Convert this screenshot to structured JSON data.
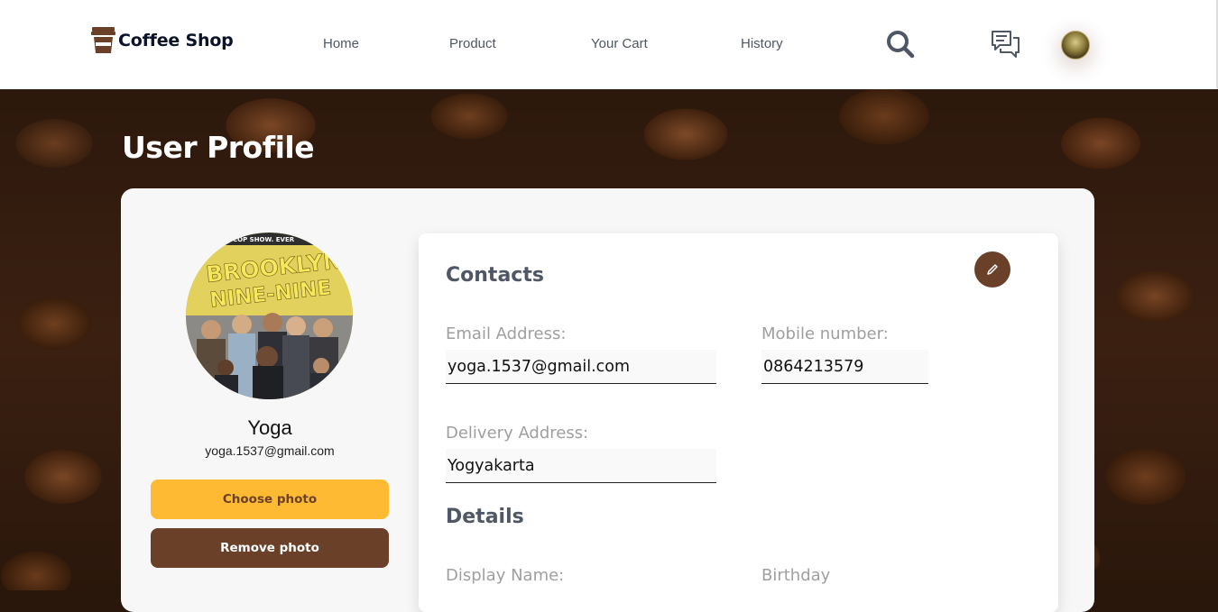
{
  "header": {
    "brand": "Coffee Shop",
    "nav": [
      "Home",
      "Product",
      "Your Cart",
      "History"
    ],
    "icons": [
      "search-icon",
      "chat-icon",
      "user-avatar"
    ]
  },
  "page": {
    "title": "User Profile"
  },
  "profile": {
    "name": "Yoga",
    "email": "yoga.1537@gmail.com",
    "poster_text": [
      "COP SHOW. EVER",
      "BROOKLYN",
      "NINE-NINE"
    ],
    "choose_photo": "Choose photo",
    "remove_photo": "Remove photo"
  },
  "contacts": {
    "title": "Contacts",
    "email_label": "Email Address:",
    "email_value": "yoga.1537@gmail.com",
    "mobile_label": "Mobile number:",
    "mobile_value": "0864213579",
    "address_label": "Delivery Address:",
    "address_value": "Yogyakarta"
  },
  "details": {
    "title": "Details",
    "display_name_label": "Display Name:",
    "birthday_label": "Birthday"
  },
  "colors": {
    "brand_brown": "#6a4029",
    "accent_yellow": "#ffba33",
    "text_dark": "#0b132a",
    "text_muted": "#4f5665"
  }
}
